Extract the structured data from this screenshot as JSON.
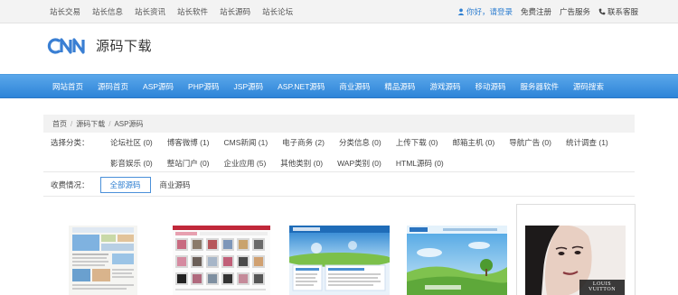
{
  "topbar": {
    "links": [
      "站长交易",
      "站长信息",
      "站长资讯",
      "站长软件",
      "站长源码",
      "站长论坛"
    ],
    "login": "你好，请登录",
    "register": "免费注册",
    "ads": "广告服务",
    "contact": "联系客服"
  },
  "logo": {
    "text": "源码下载"
  },
  "nav": [
    "网站首页",
    "源码首页",
    "ASP源码",
    "PHP源码",
    "JSP源码",
    "ASP.NET源码",
    "商业源码",
    "精品源码",
    "游戏源码",
    "移动源码",
    "服务器软件",
    "源码搜索"
  ],
  "breadcrumb": [
    "首页",
    "源码下载",
    "ASP源码"
  ],
  "filter": {
    "label": "选择分类：",
    "categories": [
      "论坛社区 (0)",
      "博客微博 (1)",
      "CMS新闻 (1)",
      "电子商务 (2)",
      "分类信息 (0)",
      "上传下载 (0)",
      "邮箱主机 (0)",
      "导航广告 (0)",
      "统计调查 (1)",
      "影音娱乐 (0)",
      "整站门户 (0)",
      "企业应用 (5)",
      "其他类别 (0)",
      "WAP类别 (0)",
      "HTML源码 (0)"
    ]
  },
  "status": {
    "label": "收费情况：",
    "tabs": [
      "全部源码",
      "商业源码"
    ]
  },
  "thumbs": {
    "card5_brand": "LOUIS VUITTON"
  },
  "colors": {
    "nav_blue": "#3a8fdf",
    "link_blue": "#2f7fd1"
  }
}
